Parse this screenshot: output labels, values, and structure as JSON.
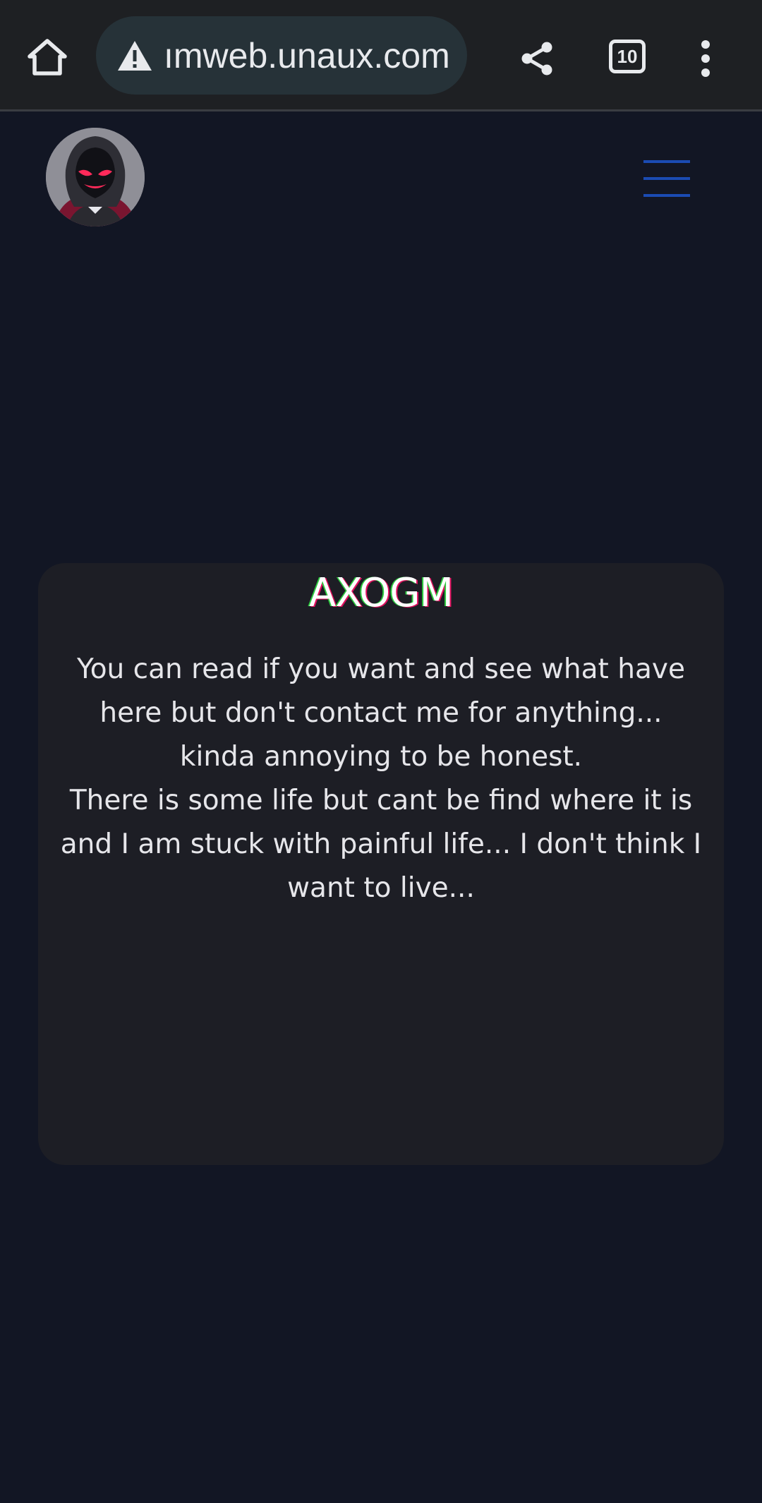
{
  "browser": {
    "url_display": "ımweb.unaux.com",
    "tab_count": "10",
    "icons": {
      "home": "home-icon",
      "security_warning": "warning-icon",
      "share": "share-icon",
      "tabs": "tab-switcher-icon",
      "menu": "more-vert-icon"
    }
  },
  "site": {
    "avatar_icon": "avatar-hooded-figure",
    "nav_icon": "hamburger-menu-icon",
    "accent_color": "#1b4bb3",
    "card": {
      "title": "AXOGM",
      "paragraphs": [
        "You can read if you want and see what have here but don't contact me for anything... kinda annoying to be honest.",
        "There is some life but cant be find where it is and I am stuck with painful life... I don't think I want to live..."
      ]
    }
  }
}
